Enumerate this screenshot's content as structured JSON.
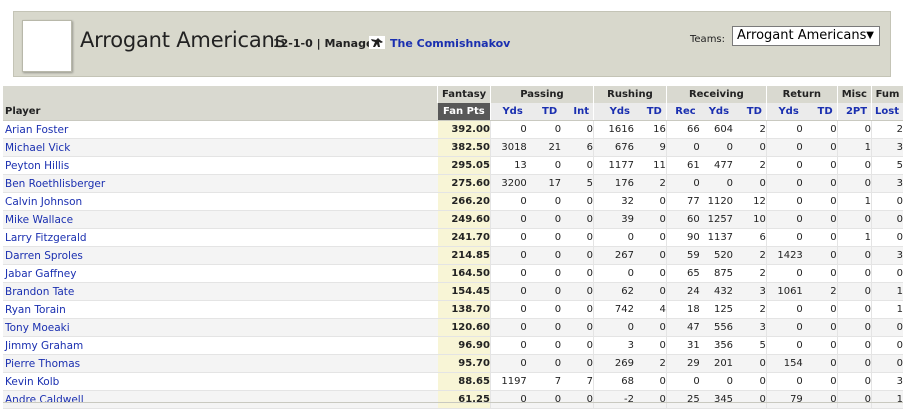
{
  "header": {
    "team_name": "Arrogant Americans",
    "record": "12-1-0",
    "manager_label": "| Manager:",
    "manager_name": "The Commishnakov",
    "manager_icon": "person-silhouette-icon",
    "teams_label": "Teams:",
    "teams_selected": "Arrogant Americans",
    "teams_arrow": "▼"
  },
  "table": {
    "groups": {
      "fantasy": "Fantasy",
      "passing": "Passing",
      "rushing": "Rushing",
      "receiving": "Receiving",
      "return": "Return",
      "misc": "Misc",
      "fum": "Fum"
    },
    "columns": {
      "player": "Player",
      "fan_pts": "Fan Pts",
      "pass_yds": "Yds",
      "pass_td": "TD",
      "pass_int": "Int",
      "rush_yds": "Yds",
      "rush_td": "TD",
      "rec_rec": "Rec",
      "rec_yds": "Yds",
      "rec_td": "TD",
      "ret_yds": "Yds",
      "ret_td": "TD",
      "misc_2pt": "2PT",
      "fum_lost": "Lost"
    },
    "rows": [
      [
        "Arian Foster",
        "392.00",
        "0",
        "0",
        "0",
        "1616",
        "16",
        "66",
        "604",
        "2",
        "0",
        "0",
        "0",
        "2"
      ],
      [
        "Michael Vick",
        "382.50",
        "3018",
        "21",
        "6",
        "676",
        "9",
        "0",
        "0",
        "0",
        "0",
        "0",
        "1",
        "3"
      ],
      [
        "Peyton Hillis",
        "295.05",
        "13",
        "0",
        "0",
        "1177",
        "11",
        "61",
        "477",
        "2",
        "0",
        "0",
        "0",
        "5"
      ],
      [
        "Ben Roethlisberger",
        "275.60",
        "3200",
        "17",
        "5",
        "176",
        "2",
        "0",
        "0",
        "0",
        "0",
        "0",
        "0",
        "3"
      ],
      [
        "Calvin Johnson",
        "266.20",
        "0",
        "0",
        "0",
        "32",
        "0",
        "77",
        "1120",
        "12",
        "0",
        "0",
        "1",
        "0"
      ],
      [
        "Mike Wallace",
        "249.60",
        "0",
        "0",
        "0",
        "39",
        "0",
        "60",
        "1257",
        "10",
        "0",
        "0",
        "0",
        "0"
      ],
      [
        "Larry Fitzgerald",
        "241.70",
        "0",
        "0",
        "0",
        "0",
        "0",
        "90",
        "1137",
        "6",
        "0",
        "0",
        "1",
        "0"
      ],
      [
        "Darren Sproles",
        "214.85",
        "0",
        "0",
        "0",
        "267",
        "0",
        "59",
        "520",
        "2",
        "1423",
        "0",
        "0",
        "3"
      ],
      [
        "Jabar Gaffney",
        "164.50",
        "0",
        "0",
        "0",
        "0",
        "0",
        "65",
        "875",
        "2",
        "0",
        "0",
        "0",
        "0"
      ],
      [
        "Brandon Tate",
        "154.45",
        "0",
        "0",
        "0",
        "62",
        "0",
        "24",
        "432",
        "3",
        "1061",
        "2",
        "0",
        "1"
      ],
      [
        "Ryan Torain",
        "138.70",
        "0",
        "0",
        "0",
        "742",
        "4",
        "18",
        "125",
        "2",
        "0",
        "0",
        "0",
        "1"
      ],
      [
        "Tony Moeaki",
        "120.60",
        "0",
        "0",
        "0",
        "0",
        "0",
        "47",
        "556",
        "3",
        "0",
        "0",
        "0",
        "0"
      ],
      [
        "Jimmy Graham",
        "96.90",
        "0",
        "0",
        "0",
        "3",
        "0",
        "31",
        "356",
        "5",
        "0",
        "0",
        "0",
        "0"
      ],
      [
        "Pierre Thomas",
        "95.70",
        "0",
        "0",
        "0",
        "269",
        "2",
        "29",
        "201",
        "0",
        "154",
        "0",
        "0",
        "0"
      ],
      [
        "Kevin Kolb",
        "88.65",
        "1197",
        "7",
        "7",
        "68",
        "0",
        "0",
        "0",
        "0",
        "0",
        "0",
        "0",
        "3"
      ],
      [
        "Andre Caldwell",
        "61.25",
        "0",
        "0",
        "0",
        "-2",
        "0",
        "25",
        "345",
        "0",
        "79",
        "0",
        "0",
        "1"
      ]
    ]
  }
}
